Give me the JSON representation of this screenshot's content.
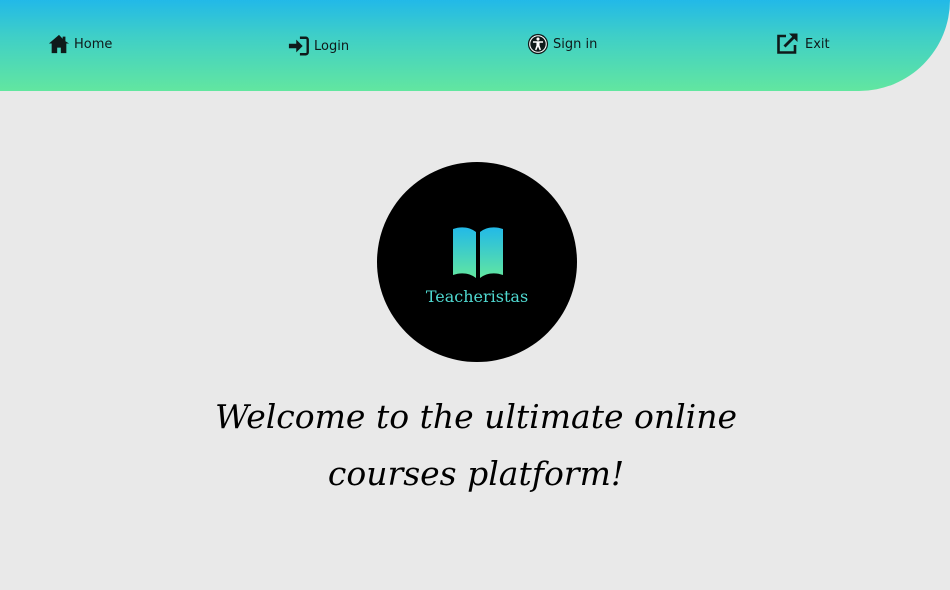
{
  "nav": {
    "items": [
      {
        "label": "Home",
        "icon": "home-icon"
      },
      {
        "label": "Login",
        "icon": "sign-in-icon"
      },
      {
        "label": "Sign in",
        "icon": "accessibility-icon"
      },
      {
        "label": "Exit",
        "icon": "external-link-icon"
      }
    ]
  },
  "brand": {
    "logo_icon": "open-book-icon",
    "name": "Teacheristas"
  },
  "hero": {
    "headline": "Welcome to the ultimate online courses platform!"
  },
  "colors": {
    "nav_gradient_top": "#22b9e8",
    "nav_gradient_bottom": "#62e6a0",
    "brand_text": "#4fd8d0",
    "page_background": "#e9e9e9"
  }
}
